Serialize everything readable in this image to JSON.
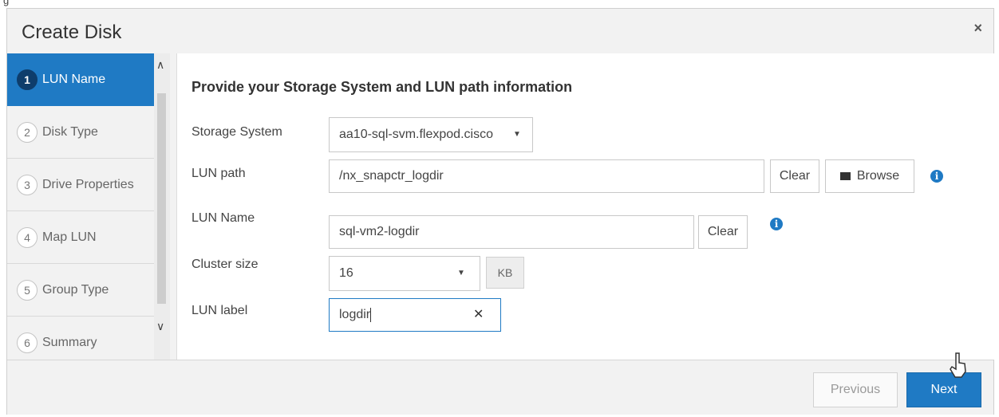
{
  "dialog": {
    "title": "Create Disk",
    "close_icon": "×"
  },
  "steps": [
    {
      "num": "1",
      "label": "LUN Name",
      "active": true
    },
    {
      "num": "2",
      "label": "Disk Type"
    },
    {
      "num": "3",
      "label": "Drive Properties"
    },
    {
      "num": "4",
      "label": "Map LUN"
    },
    {
      "num": "5",
      "label": "Group Type"
    },
    {
      "num": "6",
      "label": "Summary"
    }
  ],
  "form": {
    "heading": "Provide your Storage System and LUN path information",
    "storage_system": {
      "label": "Storage System",
      "value": "aa10-sql-svm.flexpod.cisco"
    },
    "lun_path": {
      "label": "LUN path",
      "value": "/nx_snapctr_logdir",
      "clear": "Clear",
      "browse": "Browse"
    },
    "lun_name": {
      "label": "LUN Name",
      "value": "sql-vm2-logdir",
      "clear": "Clear"
    },
    "cluster_size": {
      "label": "Cluster size",
      "value": "16",
      "unit": "KB"
    },
    "lun_label": {
      "label": "LUN label",
      "value": "logdir",
      "clear_icon": "✕"
    }
  },
  "footer": {
    "previous": "Previous",
    "next": "Next"
  },
  "colors": {
    "accent": "#1f7ac4",
    "active_step_num": "#0e3d6b",
    "dialog_bg": "#f2f2f2"
  }
}
